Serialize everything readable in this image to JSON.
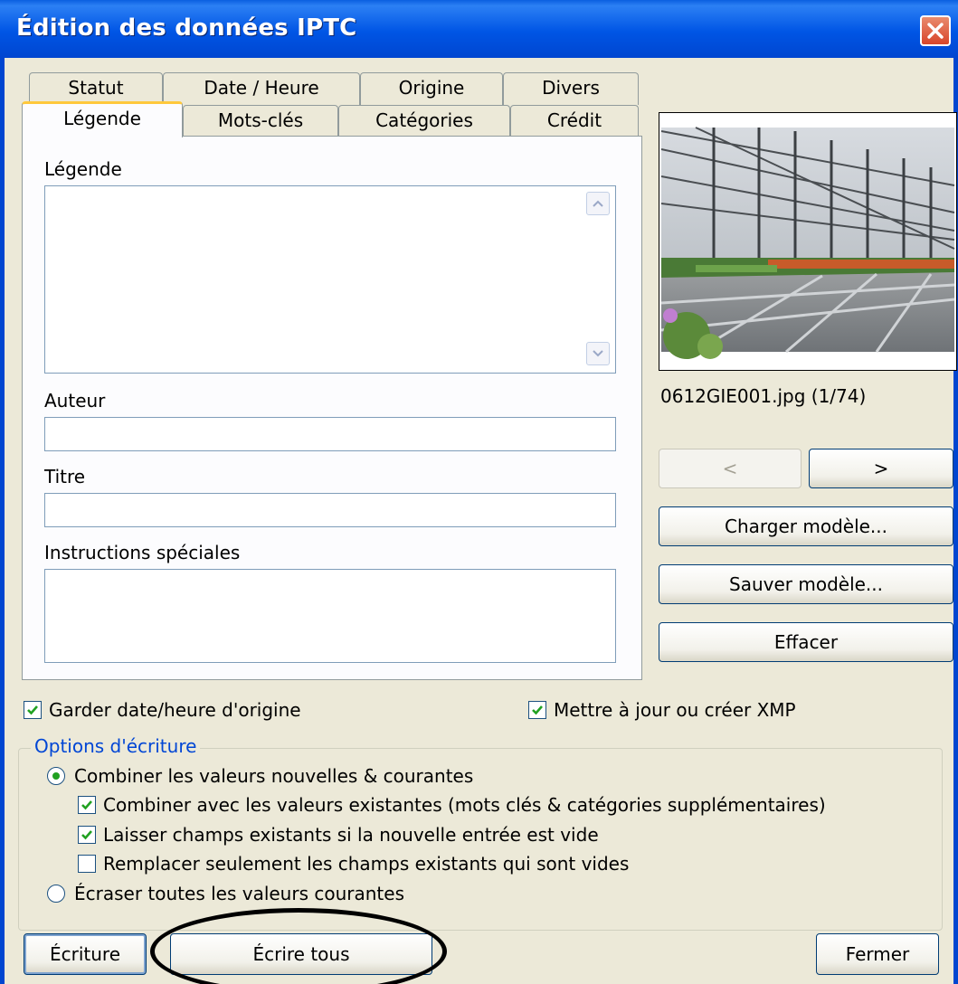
{
  "window": {
    "title": "Édition des données IPTC"
  },
  "tabs": {
    "row_back": [
      "Statut",
      "Date / Heure",
      "Origine",
      "Divers"
    ],
    "row_front": [
      "Légende",
      "Mots-clés",
      "Catégories",
      "Crédit"
    ],
    "active": "Légende"
  },
  "form": {
    "legende_label": "Légende",
    "legende_value": "",
    "auteur_label": "Auteur",
    "auteur_value": "",
    "titre_label": "Titre",
    "titre_value": "",
    "instructions_label": "Instructions spéciales",
    "instructions_value": ""
  },
  "preview": {
    "filename": "0612GIE001.jpg (1/74)"
  },
  "nav": {
    "prev_label": "<",
    "next_label": ">"
  },
  "side_buttons": {
    "charger": "Charger modèle...",
    "sauver": "Sauver modèle...",
    "effacer": "Effacer"
  },
  "options": {
    "keep_date": {
      "label": "Garder date/heure d'origine",
      "checked": true
    },
    "update_xmp": {
      "label": "Mettre à jour ou créer XMP",
      "checked": true
    },
    "group_title": "Options d'écriture",
    "combine_radio": {
      "label": "Combiner les valeurs nouvelles & courantes",
      "selected": true
    },
    "combine_existing": {
      "label": "Combiner avec les valeurs existantes (mots clés & catégories supplémentaires)",
      "checked": true
    },
    "leave_existing": {
      "label": "Laisser champs existants si la nouvelle entrée est vide",
      "checked": true
    },
    "replace_empty": {
      "label": "Remplacer seulement les champs existants qui sont vides",
      "checked": false
    },
    "overwrite_radio": {
      "label": "Écraser toutes les valeurs courantes",
      "selected": false
    }
  },
  "footer": {
    "ecriture": "Écriture",
    "ecrire_tous": "Écrire tous",
    "fermer": "Fermer"
  },
  "colors": {
    "titlebar": "#0055e5",
    "dialog_bg": "#ece9d8",
    "check_green": "#21a121",
    "group_title": "#0046d5"
  }
}
